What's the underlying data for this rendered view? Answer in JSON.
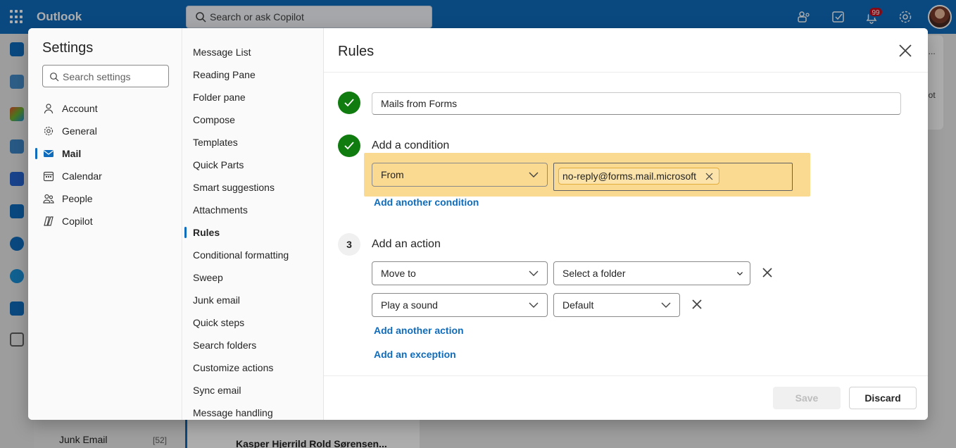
{
  "app": {
    "brand": "Outlook",
    "search_placeholder": "Search or ask Copilot",
    "notification_count": "99"
  },
  "background": {
    "junk_label": "Junk Email",
    "junk_count": "[52]",
    "mail_sender": "Kasper Hjerrild Rold Sørensen...",
    "right_card_top": "i...",
    "right_card_bottom": "lot"
  },
  "settings": {
    "title": "Settings",
    "search_placeholder": "Search settings",
    "categories": [
      {
        "label": "Account",
        "icon": "person-icon"
      },
      {
        "label": "General",
        "icon": "gear-icon"
      },
      {
        "label": "Mail",
        "icon": "mail-icon",
        "active": true
      },
      {
        "label": "Calendar",
        "icon": "calendar-icon"
      },
      {
        "label": "People",
        "icon": "people-icon"
      },
      {
        "label": "Copilot",
        "icon": "copilot-icon"
      }
    ],
    "mail_items": [
      "Message List",
      "Reading Pane",
      "Folder pane",
      "Compose",
      "Templates",
      "Quick Parts",
      "Smart suggestions",
      "Attachments",
      "Rules",
      "Conditional formatting",
      "Sweep",
      "Junk email",
      "Quick steps",
      "Search folders",
      "Customize actions",
      "Sync email",
      "Message handling"
    ],
    "active_mail_item": "Rules"
  },
  "rules": {
    "title": "Rules",
    "rule_name": "Mails from Forms",
    "condition": {
      "heading": "Add a condition",
      "field": "From",
      "value": "no-reply@forms.mail.microsoft",
      "add_link": "Add another condition"
    },
    "action": {
      "step_number": "3",
      "heading": "Add an action",
      "rows": [
        {
          "type": "Move to",
          "value": "Select a folder"
        },
        {
          "type": "Play a sound",
          "value": "Default"
        }
      ],
      "add_link": "Add another action",
      "exception_link": "Add an exception"
    },
    "save_label": "Save",
    "discard_label": "Discard"
  },
  "colors": {
    "brand": "#0f6cbd",
    "success": "#107c10",
    "highlight": "#fad991"
  }
}
